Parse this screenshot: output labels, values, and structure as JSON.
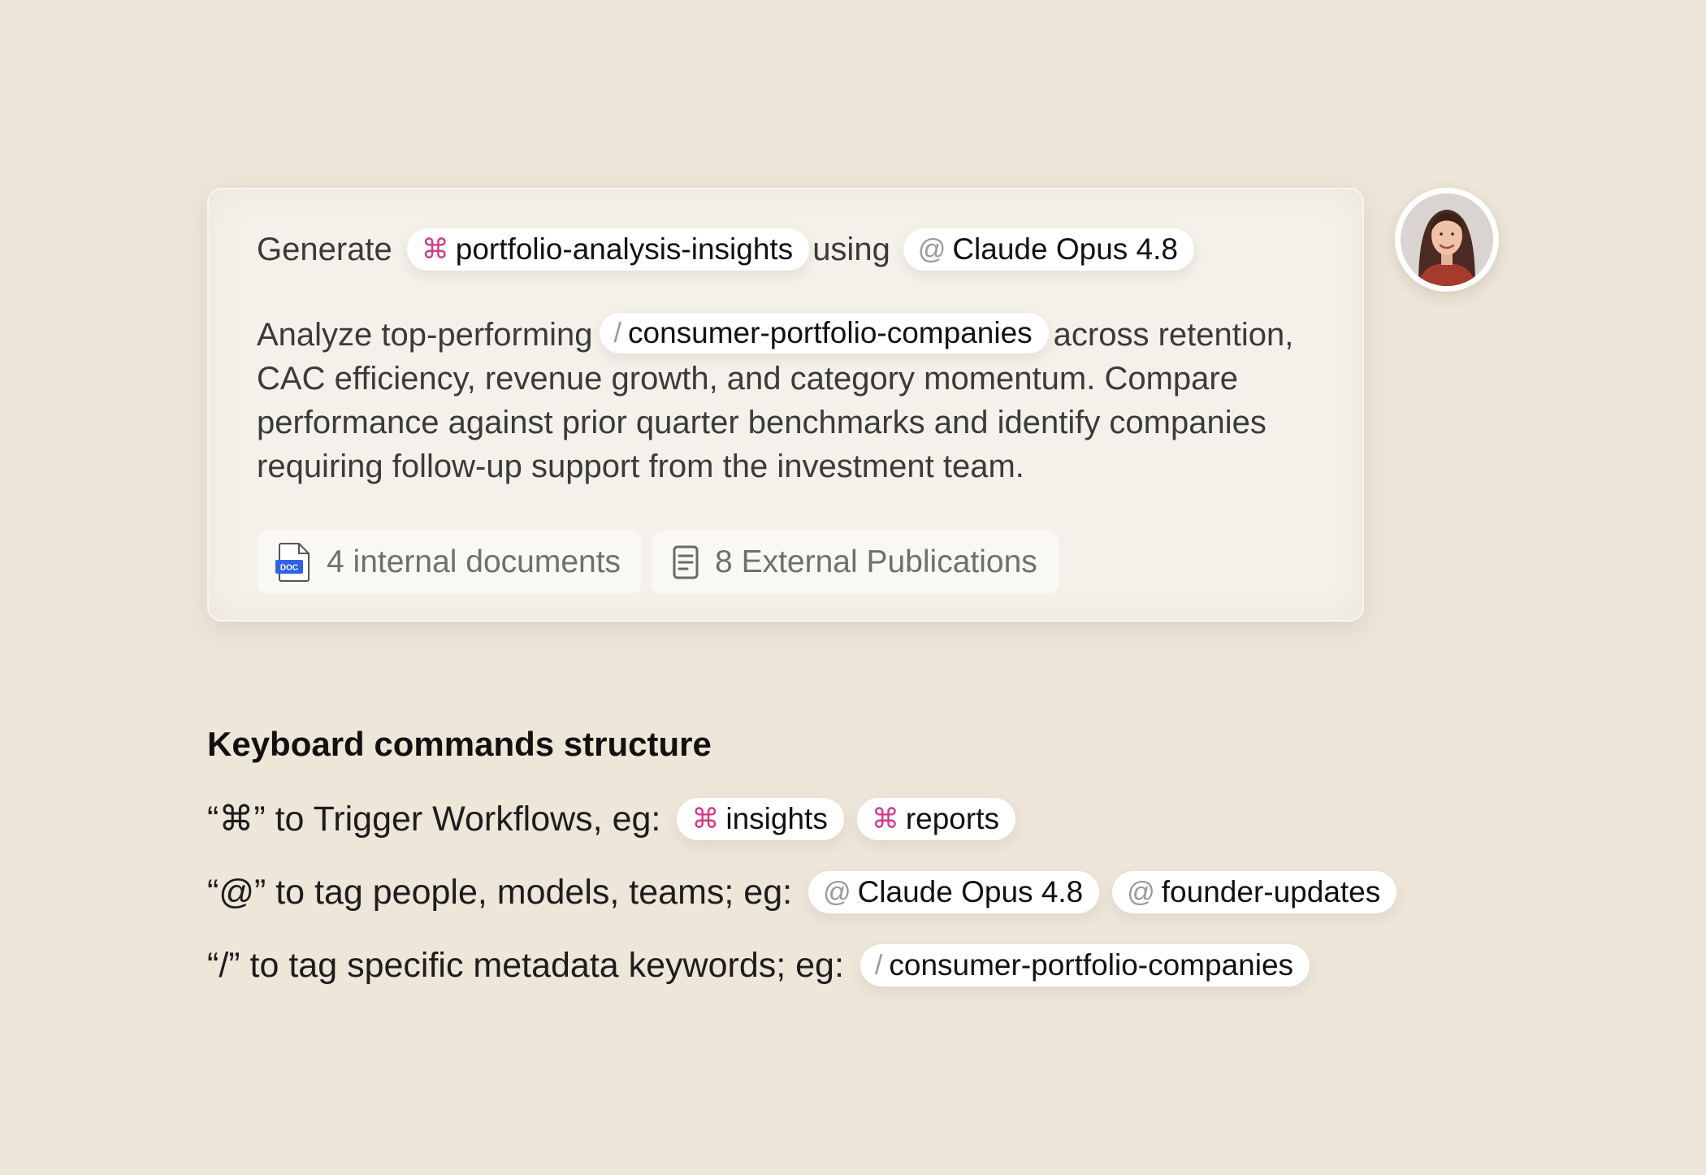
{
  "prompt": {
    "generate_label": "Generate",
    "workflow_chip": {
      "symbol": "⌘",
      "label": "portfolio-analysis-insights"
    },
    "using_label": "using",
    "model_chip": {
      "symbol": "@",
      "label": "Claude Opus 4.8"
    },
    "paragraph": {
      "before": "Analyze top-performing",
      "keyword_chip": {
        "symbol": "/",
        "label": "consumer-portfolio-companies"
      },
      "after": "across retention, CAC efficiency, revenue growth, and category momentum. Compare performance against prior quarter benchmarks and identify companies requiring follow-up support from the investment team."
    },
    "attachments": [
      {
        "icon": "doc-file-icon",
        "icon_text": "DOC",
        "label": "4 internal documents"
      },
      {
        "icon": "publication-icon",
        "label": "8 External Publications"
      }
    ]
  },
  "user": {
    "avatar": "user-avatar"
  },
  "guide": {
    "title": "Keyboard commands structure",
    "rows": [
      {
        "description": "“⌘” to Trigger Workflows, eg:",
        "chips": [
          {
            "symbol": "⌘",
            "label": "insights"
          },
          {
            "symbol": "⌘",
            "label": "reports"
          }
        ]
      },
      {
        "description": "“@” to tag people, models, teams; eg:",
        "chips": [
          {
            "symbol": "@",
            "label": "Claude Opus 4.8"
          },
          {
            "symbol": "@",
            "label": "founder-updates"
          }
        ]
      },
      {
        "description": "“/” to tag specific metadata keywords; eg:",
        "chips": [
          {
            "symbol": "/",
            "label": "consumer-portfolio-companies"
          }
        ]
      }
    ]
  },
  "colors": {
    "background": "#ede6d9",
    "card": "#f4f1ea",
    "workflow_accent": "#d23a8c",
    "doc_badge": "#2f62e6"
  }
}
